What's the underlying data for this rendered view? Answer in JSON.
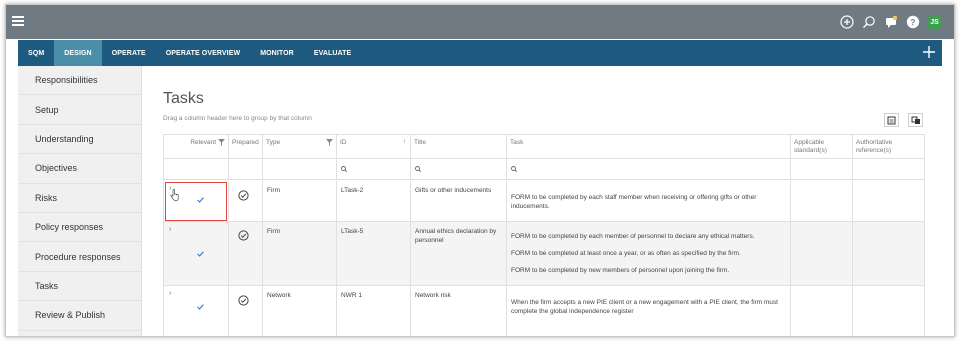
{
  "nav": {
    "tabs": [
      {
        "label": "SQM",
        "active": false
      },
      {
        "label": "DESIGN",
        "active": true
      },
      {
        "label": "OPERATE",
        "active": false
      },
      {
        "label": "OPERATE OVERVIEW",
        "active": false
      },
      {
        "label": "MONITOR",
        "active": false
      },
      {
        "label": "EVALUATE",
        "active": false
      }
    ]
  },
  "appbar": {
    "avatar_initials": "JS",
    "icons": [
      "add-circle-icon",
      "search-icon",
      "chat-icon",
      "help-icon"
    ]
  },
  "sidebar": {
    "items": [
      {
        "label": "Responsibilities"
      },
      {
        "label": "Setup"
      },
      {
        "label": "Understanding"
      },
      {
        "label": "Objectives"
      },
      {
        "label": "Risks"
      },
      {
        "label": "Policy responses"
      },
      {
        "label": "Procedure responses"
      },
      {
        "label": "Tasks"
      },
      {
        "label": "Review & Publish"
      }
    ]
  },
  "page": {
    "title": "Tasks",
    "group_hint": "Drag a column header here to group by that column"
  },
  "grid": {
    "columns": {
      "relevant": "Relevant",
      "prepared": "Prepared",
      "type": "Type",
      "id": "ID",
      "title": "Title",
      "task": "Task",
      "applicable": "Applicable standard(s)",
      "authoritative": "Authoritative reference(s)"
    },
    "rows": [
      {
        "type": "Firm",
        "id": "LTask-2",
        "title": "Gifts or other inducements",
        "task": [
          "FORM to be completed by each staff member when receiving or offering gifts or other inducements."
        ]
      },
      {
        "type": "Firm",
        "id": "LTask-5",
        "title": "Annual ethics declaration by personnel",
        "task": [
          "FORM to be completed by each member of personnel to declare any ethical matters.",
          "FORM to be completed at least once a year, or as often as specified by the firm.",
          "FORM to be completed by new members of personnel upon joining the firm."
        ]
      },
      {
        "type": "Network",
        "id": "NWR 1",
        "title": "Network risk",
        "task": [
          "When the firm accepts a new PIE client or a new engagement with a PIE client, the firm must complete the global independence register"
        ]
      }
    ]
  },
  "colors": {
    "appbar": "#6f7a83",
    "navbar": "#1e5a7f",
    "nav_active": "#4b8ea8",
    "highlight": "#e0463b",
    "check": "#3b6fd6"
  }
}
